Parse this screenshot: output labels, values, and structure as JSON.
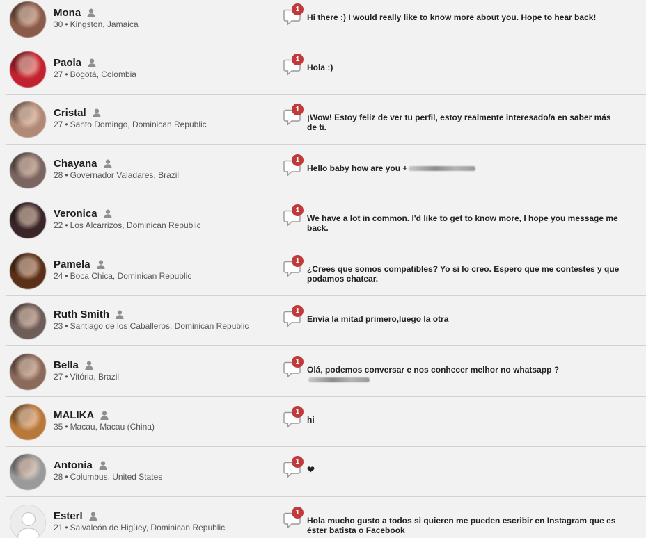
{
  "profiles": [
    {
      "name": "Mona",
      "age": "30",
      "location": "Kingston, Jamaica",
      "badge": "1",
      "message": "Hi there :) I would really like to know more about you. Hope to hear back!",
      "avatar_color": "#8a5a4a"
    },
    {
      "name": "Paola",
      "age": "27",
      "location": "Bogotá, Colombia",
      "badge": "1",
      "message": "Hola :)",
      "avatar_color": "#c2222f"
    },
    {
      "name": "Cristal",
      "age": "27",
      "location": "Santo Domingo, Dominican Republic",
      "badge": "1",
      "message": "¡Wow! Estoy feliz de ver tu perfil, estoy realmente interesado/a en saber más de ti.",
      "avatar_color": "#b08a76"
    },
    {
      "name": "Chayana",
      "age": "28",
      "location": "Governador Valadares, Brazil",
      "badge": "1",
      "message": "Hello baby how are you +",
      "avatar_color": "#7a6560"
    },
    {
      "name": "Veronica",
      "age": "22",
      "location": "Los Alcarrizos, Dominican Republic",
      "badge": "1",
      "message": "We have a lot in common. I'd like to get to know more, I hope you message me back.",
      "avatar_color": "#3a2628"
    },
    {
      "name": "Pamela",
      "age": "24",
      "location": "Boca Chica, Dominican Republic",
      "badge": "1",
      "message": "¿Crees que somos compatibles? Yo si lo creo. Espero que me contestes y que podamos chatear.",
      "avatar_color": "#5a3018"
    },
    {
      "name": "Ruth Smith",
      "age": "23",
      "location": "Santiago de los Caballeros, Dominican Republic",
      "badge": "1",
      "message": "Envía la mitad primero,luego la otra",
      "avatar_color": "#6e5c58"
    },
    {
      "name": "Bella",
      "age": "27",
      "location": "Vitória, Brazil",
      "badge": "1",
      "message": "Olá, podemos conversar e nos conhecer melhor no whatsapp ?",
      "avatar_color": "#8b6a5c"
    },
    {
      "name": "MALIKA",
      "age": "35",
      "location": "Macau, Macau (China)",
      "badge": "1",
      "message": "hi",
      "avatar_color": "#b8783a"
    },
    {
      "name": "Antonia",
      "age": "28",
      "location": "Columbus, United States",
      "badge": "1",
      "message": "❤",
      "avatar_color": "#9a9a9a"
    },
    {
      "name": "Esterl",
      "age": "21",
      "location": "Salvaleón de Higüey, Dominican Republic",
      "badge": "1",
      "message": "Hola mucho gusto a todos si quieren me pueden escribir en Instagram que es éster batista o Facebook",
      "avatar_color": "#ececec"
    }
  ],
  "icons": {
    "user": "person-icon",
    "chat": "speech-bubble-icon",
    "badge_color": "#c0393b"
  }
}
